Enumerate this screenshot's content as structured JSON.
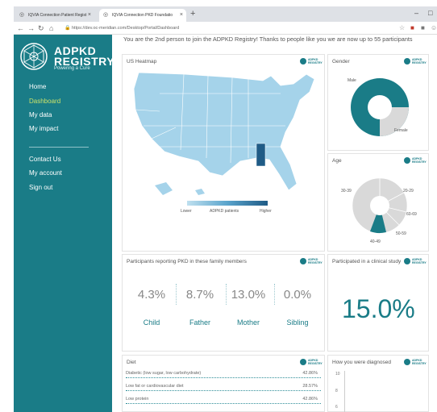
{
  "browser": {
    "tabs": [
      {
        "label": "IQVIA Connection Patient Regist"
      },
      {
        "label": "IQVIA Connection PKD Foundatio"
      }
    ],
    "new_tab": "+",
    "url": "https://dev.oc-meridian.com/Desktop/Portal/Dashboard"
  },
  "sidebar": {
    "brand_line1": "ADPKD",
    "brand_line2": "REGISTRY",
    "tagline": "Powering a Cure",
    "nav": [
      {
        "label": "Home"
      },
      {
        "label": "Dashboard"
      },
      {
        "label": "My data"
      },
      {
        "label": "My impact"
      }
    ],
    "nav2": [
      {
        "label": "Contact Us"
      },
      {
        "label": "My account"
      },
      {
        "label": "Sign out"
      }
    ]
  },
  "banner": "You are the 2nd person to join the ADPKD Registry! Thanks to people like you we are now up to 55 participants",
  "badge": {
    "line1": "ADPKD",
    "line2": "REGISTRY"
  },
  "heatmap": {
    "title": "US Heatmap",
    "legend_low": "Lower",
    "legend_mid": "ADPKD patients",
    "legend_high": "Higher",
    "colors": {
      "low": "#bfe0ef",
      "high": "#1f5b86"
    }
  },
  "gender": {
    "title": "Gender",
    "labels": [
      "Male",
      "Female"
    ]
  },
  "age": {
    "title": "Age",
    "labels": [
      "30-39",
      "20-29",
      "60-69",
      "50-59",
      "40-49"
    ]
  },
  "family": {
    "title": "Participants reporting PKD in these family members",
    "stats": [
      {
        "pct": "4.3%",
        "label": "Child"
      },
      {
        "pct": "8.7%",
        "label": "Father"
      },
      {
        "pct": "13.0%",
        "label": "Mother"
      },
      {
        "pct": "0.0%",
        "label": "Sibling"
      }
    ]
  },
  "clinical": {
    "title": "Participated in a clinical study",
    "value": "15.0%"
  },
  "diet": {
    "title": "Diet",
    "rows": [
      {
        "label": "Diabetic (low sugar, low carbohydrate)",
        "value": "42.86%"
      },
      {
        "label": "Low fat or cardiovascular diet",
        "value": "28.57%"
      },
      {
        "label": "Low protein",
        "value": "42.86%"
      }
    ]
  },
  "diagnosed": {
    "title": "How you were diagnosed",
    "yticks": [
      "10",
      "8",
      "6"
    ]
  },
  "colors": {
    "accent": "#1a7c87",
    "active_nav": "#c9e26a"
  }
}
